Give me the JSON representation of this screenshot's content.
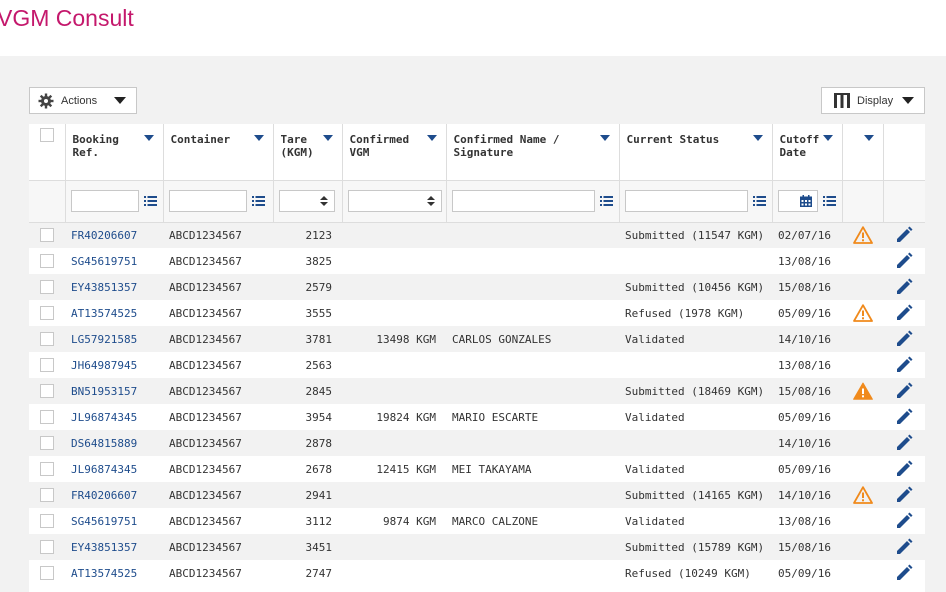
{
  "app": {
    "title": "VGM Consult"
  },
  "toolbar": {
    "actions_label": "Actions",
    "display_label": "Display",
    "actions_icon": "gear-icon",
    "display_icon": "columns-icon"
  },
  "colors": {
    "brand": "#c4186c",
    "link": "#1e4c8c",
    "warning": "#f08a1c"
  },
  "columns": [
    {
      "key": "booking_ref",
      "label_line1": "Booking",
      "label_line2": "Ref."
    },
    {
      "key": "container",
      "label_line1": "Container",
      "label_line2": ""
    },
    {
      "key": "tare",
      "label_line1": "Tare",
      "label_line2": "(KGM)"
    },
    {
      "key": "confirmed_vgm",
      "label_line1": "Confirmed",
      "label_line2": "VGM"
    },
    {
      "key": "confirmed_name",
      "label_line1": "Confirmed Name /",
      "label_line2": "Signature"
    },
    {
      "key": "current_status",
      "label_line1": "Current Status",
      "label_line2": ""
    },
    {
      "key": "cutoff_date",
      "label_line1": "Cutoff",
      "label_line2": "Date"
    }
  ],
  "rows": [
    {
      "booking_ref": "FR40206607",
      "container": "ABCD1234567",
      "tare": "2123",
      "confirmed_vgm": "",
      "confirmed_name": "",
      "current_status": "Submitted (11547 KGM)",
      "cutoff_date": "02/07/16",
      "warning": "outline"
    },
    {
      "booking_ref": "SG45619751",
      "container": "ABCD1234567",
      "tare": "3825",
      "confirmed_vgm": "",
      "confirmed_name": "",
      "current_status": "",
      "cutoff_date": "13/08/16",
      "warning": "none"
    },
    {
      "booking_ref": "EY43851357",
      "container": "ABCD1234567",
      "tare": "2579",
      "confirmed_vgm": "",
      "confirmed_name": "",
      "current_status": "Submitted (10456 KGM)",
      "cutoff_date": "15/08/16",
      "warning": "none"
    },
    {
      "booking_ref": "AT13574525",
      "container": "ABCD1234567",
      "tare": "3555",
      "confirmed_vgm": "",
      "confirmed_name": "",
      "current_status": "Refused (1978 KGM)",
      "cutoff_date": "05/09/16",
      "warning": "outline"
    },
    {
      "booking_ref": "LG57921585",
      "container": "ABCD1234567",
      "tare": "3781",
      "confirmed_vgm": "13498 KGM",
      "confirmed_name": "CARLOS GONZALES",
      "current_status": "Validated",
      "cutoff_date": "14/10/16",
      "warning": "none"
    },
    {
      "booking_ref": "JH64987945",
      "container": "ABCD1234567",
      "tare": "2563",
      "confirmed_vgm": "",
      "confirmed_name": "",
      "current_status": "",
      "cutoff_date": "13/08/16",
      "warning": "none"
    },
    {
      "booking_ref": "BN51953157",
      "container": "ABCD1234567",
      "tare": "2845",
      "confirmed_vgm": "",
      "confirmed_name": "",
      "current_status": "Submitted (18469 KGM)",
      "cutoff_date": "15/08/16",
      "warning": "filled"
    },
    {
      "booking_ref": "JL96874345",
      "container": "ABCD1234567",
      "tare": "3954",
      "confirmed_vgm": "19824 KGM",
      "confirmed_name": "MARIO ESCARTE",
      "current_status": "Validated",
      "cutoff_date": "05/09/16",
      "warning": "none"
    },
    {
      "booking_ref": "DS64815889",
      "container": "ABCD1234567",
      "tare": "2878",
      "confirmed_vgm": "",
      "confirmed_name": "",
      "current_status": "",
      "cutoff_date": "14/10/16",
      "warning": "none"
    },
    {
      "booking_ref": "JL96874345",
      "container": "ABCD1234567",
      "tare": "2678",
      "confirmed_vgm": "12415 KGM",
      "confirmed_name": "MEI TAKAYAMA",
      "current_status": "Validated",
      "cutoff_date": "05/09/16",
      "warning": "none"
    },
    {
      "booking_ref": "FR40206607",
      "container": "ABCD1234567",
      "tare": "2941",
      "confirmed_vgm": "",
      "confirmed_name": "",
      "current_status": "Submitted (14165 KGM)",
      "cutoff_date": "14/10/16",
      "warning": "outline"
    },
    {
      "booking_ref": "SG45619751",
      "container": "ABCD1234567",
      "tare": "3112",
      "confirmed_vgm": "9874 KGM",
      "confirmed_name": "MARCO CALZONE",
      "current_status": "Validated",
      "cutoff_date": "13/08/16",
      "warning": "none"
    },
    {
      "booking_ref": "EY43851357",
      "container": "ABCD1234567",
      "tare": "3451",
      "confirmed_vgm": "",
      "confirmed_name": "",
      "current_status": "Submitted (15789 KGM)",
      "cutoff_date": "15/08/16",
      "warning": "none"
    },
    {
      "booking_ref": "AT13574525",
      "container": "ABCD1234567",
      "tare": "2747",
      "confirmed_vgm": "",
      "confirmed_name": "",
      "current_status": "Refused (10249 KGM)",
      "cutoff_date": "05/09/16",
      "warning": "none"
    }
  ]
}
